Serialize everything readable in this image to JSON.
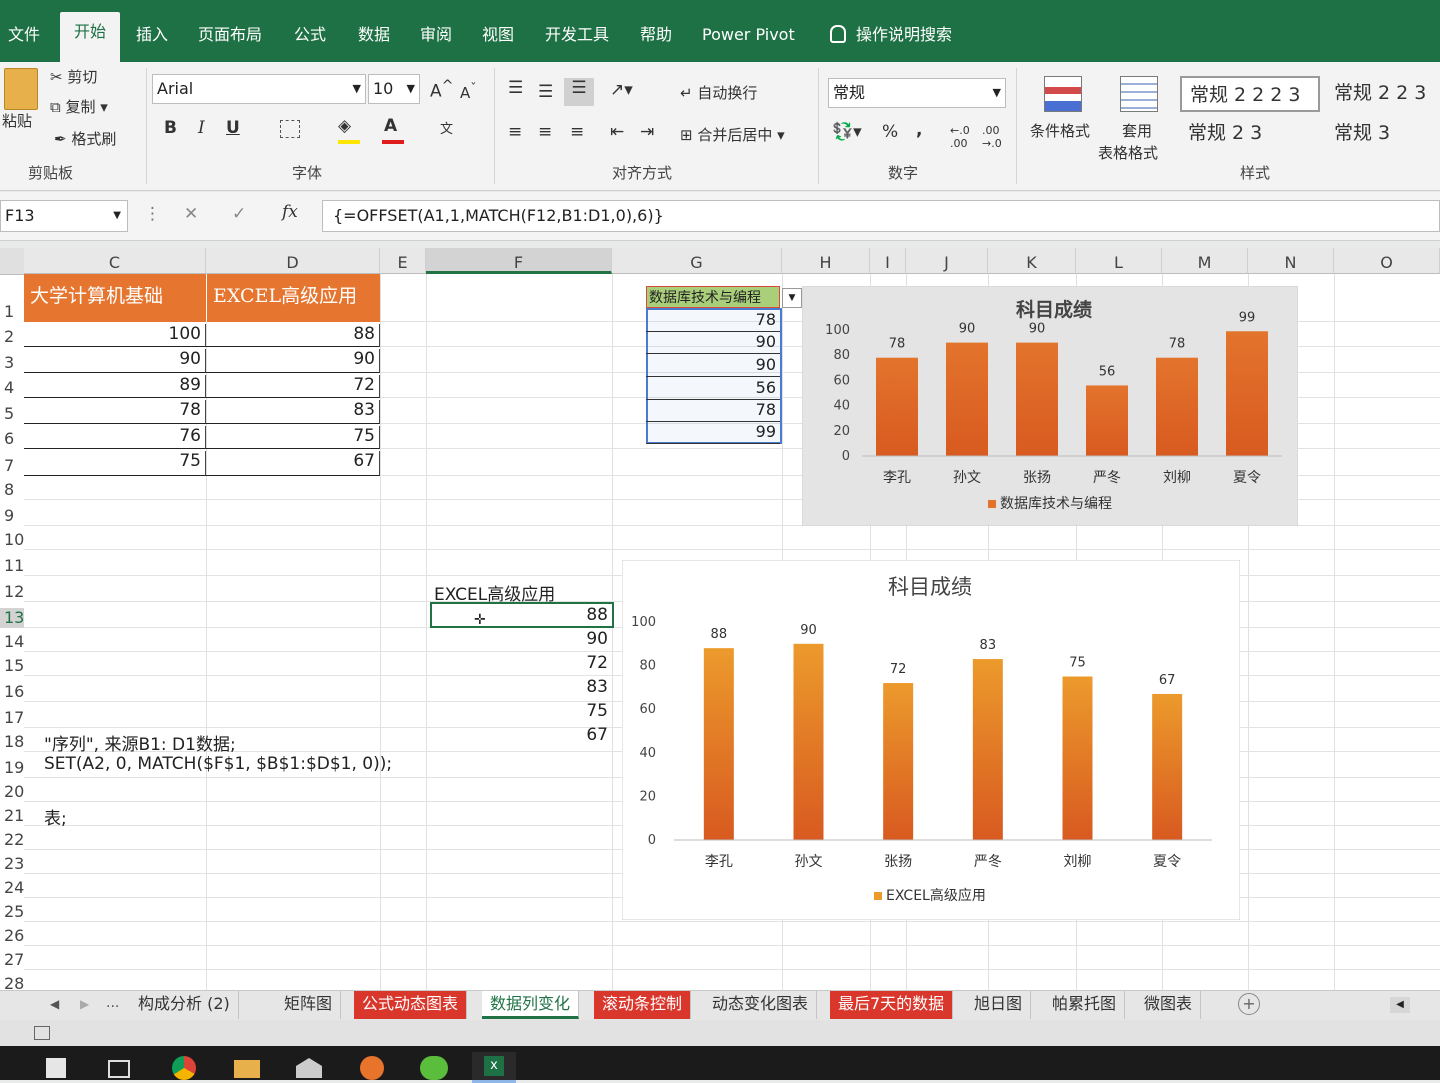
{
  "menu": {
    "tabs": [
      "文件",
      "开始",
      "插入",
      "页面布局",
      "公式",
      "数据",
      "审阅",
      "视图",
      "开发工具",
      "帮助",
      "Power Pivot"
    ],
    "search": "操作说明搜索"
  },
  "ribbon": {
    "clipboard": {
      "paste": "粘贴",
      "cut": "剪切",
      "copy": "复制",
      "format_painter": "格式刷",
      "label": "剪贴板"
    },
    "font": {
      "name": "Arial",
      "size": "10",
      "bold": "B",
      "italic": "I",
      "underline": "U",
      "font_color_letter": "A",
      "label": "字体"
    },
    "alignment": {
      "wrap": "自动换行",
      "merge": "合并后居中",
      "label": "对齐方式"
    },
    "number": {
      "format": "常规",
      "percent": "%",
      "comma": ",",
      "label": "数字"
    },
    "styles": {
      "conditional": "条件格式",
      "table_format_1": "套用",
      "table_format_2": "表格格式",
      "style1": "常规 2 2 2 3",
      "style2": "常规 2 2 3",
      "style3": "常规 2 3",
      "style4": "常规 3",
      "label": "样式"
    }
  },
  "formula_bar": {
    "name_box": "F13",
    "fx": "fx",
    "formula": "{=OFFSET(A1,1,MATCH(F12,B1:D1,0),6)}"
  },
  "columns": [
    "C",
    "D",
    "E",
    "F",
    "G",
    "H",
    "I",
    "J",
    "K",
    "L",
    "M",
    "N",
    "O"
  ],
  "rows": [
    "1",
    "2",
    "3",
    "4",
    "5",
    "6",
    "7",
    "8",
    "9",
    "10",
    "11",
    "12",
    "13",
    "14",
    "15",
    "16",
    "17",
    "18",
    "19",
    "20",
    "21",
    "22",
    "23",
    "24",
    "25",
    "26",
    "27",
    "28"
  ],
  "table": {
    "header_c": "大学计算机基础",
    "header_d": "EXCEL高级应用",
    "col_c": [
      "100",
      "90",
      "89",
      "78",
      "76",
      "75"
    ],
    "col_d": [
      "88",
      "90",
      "72",
      "83",
      "75",
      "67"
    ]
  },
  "notes": {
    "row18": "\"序列\", 来源B1: D1数据;",
    "row19": "SET(A2, 0, MATCH($F$1, $B$1:$D$1, 0));",
    "row21": "表;"
  },
  "dropdown": {
    "value": "数据库技术与编程",
    "values": [
      "78",
      "90",
      "90",
      "56",
      "78",
      "99"
    ]
  },
  "dynamic": {
    "header": "EXCEL高级应用",
    "values": [
      "88",
      "90",
      "72",
      "83",
      "75",
      "67"
    ]
  },
  "chart_data": [
    {
      "type": "bar",
      "title": "科目成绩",
      "categories": [
        "李孔",
        "孙文",
        "张扬",
        "严冬",
        "刘柳",
        "夏令"
      ],
      "series": [
        {
          "name": "数据库技术与编程",
          "values": [
            78,
            90,
            90,
            56,
            78,
            99
          ]
        }
      ],
      "ylim": [
        0,
        100
      ],
      "yticks": [
        "0",
        "20",
        "40",
        "60",
        "80",
        "100"
      ],
      "legend": "bottom",
      "color": "#e3742c"
    },
    {
      "type": "bar",
      "title": "科目成绩",
      "categories": [
        "李孔",
        "孙文",
        "张扬",
        "严冬",
        "刘柳",
        "夏令"
      ],
      "series": [
        {
          "name": "EXCEL高级应用",
          "values": [
            88,
            90,
            72,
            83,
            75,
            67
          ]
        }
      ],
      "ylim": [
        0,
        100
      ],
      "yticks": [
        "0",
        "20",
        "40",
        "60",
        "80",
        "100"
      ],
      "legend": "bottom",
      "color": "#ec9a2c"
    }
  ],
  "sheet_tabs": {
    "nav": "...",
    "tabs": [
      "构成分析 (2)",
      "矩阵图",
      "公式动态图表",
      "数据列变化",
      "滚动条控制",
      "动态变化图表",
      "最后7天的数据",
      "旭日图",
      "帕累托图",
      "微图表"
    ]
  },
  "colors": {
    "ribbon_green": "#1e7145",
    "header_orange": "#e5752f",
    "selection_green": "#217346",
    "tab_red": "#d9362c"
  }
}
